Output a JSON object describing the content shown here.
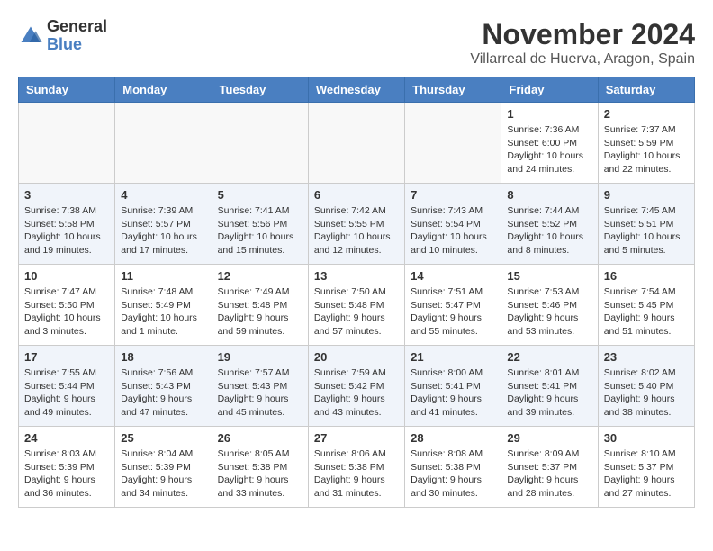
{
  "header": {
    "logo_general": "General",
    "logo_blue": "Blue",
    "title": "November 2024",
    "location": "Villarreal de Huerva, Aragon, Spain"
  },
  "weekdays": [
    "Sunday",
    "Monday",
    "Tuesday",
    "Wednesday",
    "Thursday",
    "Friday",
    "Saturday"
  ],
  "weeks": [
    [
      {
        "day": "",
        "info": ""
      },
      {
        "day": "",
        "info": ""
      },
      {
        "day": "",
        "info": ""
      },
      {
        "day": "",
        "info": ""
      },
      {
        "day": "",
        "info": ""
      },
      {
        "day": "1",
        "info": "Sunrise: 7:36 AM\nSunset: 6:00 PM\nDaylight: 10 hours and 24 minutes."
      },
      {
        "day": "2",
        "info": "Sunrise: 7:37 AM\nSunset: 5:59 PM\nDaylight: 10 hours and 22 minutes."
      }
    ],
    [
      {
        "day": "3",
        "info": "Sunrise: 7:38 AM\nSunset: 5:58 PM\nDaylight: 10 hours and 19 minutes."
      },
      {
        "day": "4",
        "info": "Sunrise: 7:39 AM\nSunset: 5:57 PM\nDaylight: 10 hours and 17 minutes."
      },
      {
        "day": "5",
        "info": "Sunrise: 7:41 AM\nSunset: 5:56 PM\nDaylight: 10 hours and 15 minutes."
      },
      {
        "day": "6",
        "info": "Sunrise: 7:42 AM\nSunset: 5:55 PM\nDaylight: 10 hours and 12 minutes."
      },
      {
        "day": "7",
        "info": "Sunrise: 7:43 AM\nSunset: 5:54 PM\nDaylight: 10 hours and 10 minutes."
      },
      {
        "day": "8",
        "info": "Sunrise: 7:44 AM\nSunset: 5:52 PM\nDaylight: 10 hours and 8 minutes."
      },
      {
        "day": "9",
        "info": "Sunrise: 7:45 AM\nSunset: 5:51 PM\nDaylight: 10 hours and 5 minutes."
      }
    ],
    [
      {
        "day": "10",
        "info": "Sunrise: 7:47 AM\nSunset: 5:50 PM\nDaylight: 10 hours and 3 minutes."
      },
      {
        "day": "11",
        "info": "Sunrise: 7:48 AM\nSunset: 5:49 PM\nDaylight: 10 hours and 1 minute."
      },
      {
        "day": "12",
        "info": "Sunrise: 7:49 AM\nSunset: 5:48 PM\nDaylight: 9 hours and 59 minutes."
      },
      {
        "day": "13",
        "info": "Sunrise: 7:50 AM\nSunset: 5:48 PM\nDaylight: 9 hours and 57 minutes."
      },
      {
        "day": "14",
        "info": "Sunrise: 7:51 AM\nSunset: 5:47 PM\nDaylight: 9 hours and 55 minutes."
      },
      {
        "day": "15",
        "info": "Sunrise: 7:53 AM\nSunset: 5:46 PM\nDaylight: 9 hours and 53 minutes."
      },
      {
        "day": "16",
        "info": "Sunrise: 7:54 AM\nSunset: 5:45 PM\nDaylight: 9 hours and 51 minutes."
      }
    ],
    [
      {
        "day": "17",
        "info": "Sunrise: 7:55 AM\nSunset: 5:44 PM\nDaylight: 9 hours and 49 minutes."
      },
      {
        "day": "18",
        "info": "Sunrise: 7:56 AM\nSunset: 5:43 PM\nDaylight: 9 hours and 47 minutes."
      },
      {
        "day": "19",
        "info": "Sunrise: 7:57 AM\nSunset: 5:43 PM\nDaylight: 9 hours and 45 minutes."
      },
      {
        "day": "20",
        "info": "Sunrise: 7:59 AM\nSunset: 5:42 PM\nDaylight: 9 hours and 43 minutes."
      },
      {
        "day": "21",
        "info": "Sunrise: 8:00 AM\nSunset: 5:41 PM\nDaylight: 9 hours and 41 minutes."
      },
      {
        "day": "22",
        "info": "Sunrise: 8:01 AM\nSunset: 5:41 PM\nDaylight: 9 hours and 39 minutes."
      },
      {
        "day": "23",
        "info": "Sunrise: 8:02 AM\nSunset: 5:40 PM\nDaylight: 9 hours and 38 minutes."
      }
    ],
    [
      {
        "day": "24",
        "info": "Sunrise: 8:03 AM\nSunset: 5:39 PM\nDaylight: 9 hours and 36 minutes."
      },
      {
        "day": "25",
        "info": "Sunrise: 8:04 AM\nSunset: 5:39 PM\nDaylight: 9 hours and 34 minutes."
      },
      {
        "day": "26",
        "info": "Sunrise: 8:05 AM\nSunset: 5:38 PM\nDaylight: 9 hours and 33 minutes."
      },
      {
        "day": "27",
        "info": "Sunrise: 8:06 AM\nSunset: 5:38 PM\nDaylight: 9 hours and 31 minutes."
      },
      {
        "day": "28",
        "info": "Sunrise: 8:08 AM\nSunset: 5:38 PM\nDaylight: 9 hours and 30 minutes."
      },
      {
        "day": "29",
        "info": "Sunrise: 8:09 AM\nSunset: 5:37 PM\nDaylight: 9 hours and 28 minutes."
      },
      {
        "day": "30",
        "info": "Sunrise: 8:10 AM\nSunset: 5:37 PM\nDaylight: 9 hours and 27 minutes."
      }
    ]
  ]
}
